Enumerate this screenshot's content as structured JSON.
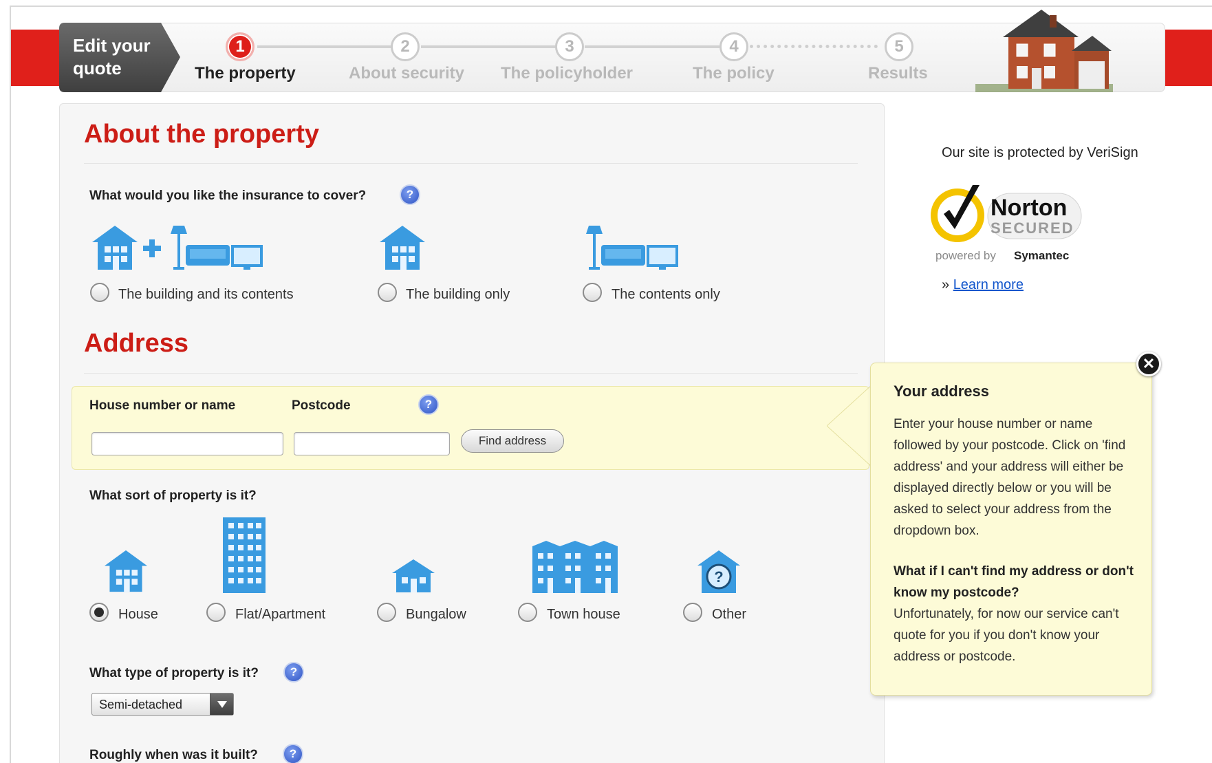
{
  "progress": {
    "edit_quote_label": "Edit your quote",
    "steps": [
      {
        "number": "1",
        "label": "The property",
        "active": true
      },
      {
        "number": "2",
        "label": "About security",
        "active": false
      },
      {
        "number": "3",
        "label": "The policyholder",
        "active": false
      },
      {
        "number": "4",
        "label": "The policy",
        "active": false
      },
      {
        "number": "5",
        "label": "Results",
        "active": false
      }
    ]
  },
  "property_section": {
    "title": "About the property",
    "cover_question": "What would you like the insurance to cover?",
    "cover_options": [
      {
        "label": "The building and its contents",
        "selected": false
      },
      {
        "label": "The building only",
        "selected": false
      },
      {
        "label": "The contents only",
        "selected": false
      }
    ]
  },
  "address_section": {
    "title": "Address",
    "house_label": "House number or name",
    "postcode_label": "Postcode",
    "house_value": "",
    "postcode_value": "",
    "find_button": "Find address"
  },
  "property_sort": {
    "question": "What sort of property is it?",
    "options": [
      {
        "label": "House",
        "selected": true
      },
      {
        "label": "Flat/Apartment",
        "selected": false
      },
      {
        "label": "Bungalow",
        "selected": false
      },
      {
        "label": "Town house",
        "selected": false
      },
      {
        "label": "Other",
        "selected": false
      }
    ]
  },
  "property_type": {
    "question": "What type of property is it?",
    "selected": "Semi-detached"
  },
  "built_question": "Roughly when was it built?",
  "security": {
    "verisign_text": "Our site is protected by VeriSign",
    "norton_name": "Norton",
    "norton_secured": "SECURED",
    "powered_by": "powered by",
    "symantec": "Symantec",
    "learn_prefix": "»",
    "learn_more": "Learn more"
  },
  "tooltip": {
    "title": "Your address",
    "body": "Enter your house number or name followed by your postcode. Click on 'find address' and your address will either be displayed directly below or you will be asked to select your address from the dropdown box.",
    "question": "What if I can't find my address or don't know my postcode?",
    "answer": "Unfortunately, for now our service can't quote for you if you don't know your address or postcode."
  },
  "colors": {
    "brand_red": "#e0201b",
    "heading_red": "#cc1d16",
    "tooltip_bg": "#fdfbd7",
    "icon_blue": "#3a9be0"
  },
  "icons": [
    "house-icon",
    "sofa-lamp-icon",
    "tv-icon",
    "flat-icon",
    "bungalow-icon",
    "townhouse-icon",
    "other-property-icon",
    "help-icon",
    "close-icon",
    "norton-check-icon"
  ]
}
